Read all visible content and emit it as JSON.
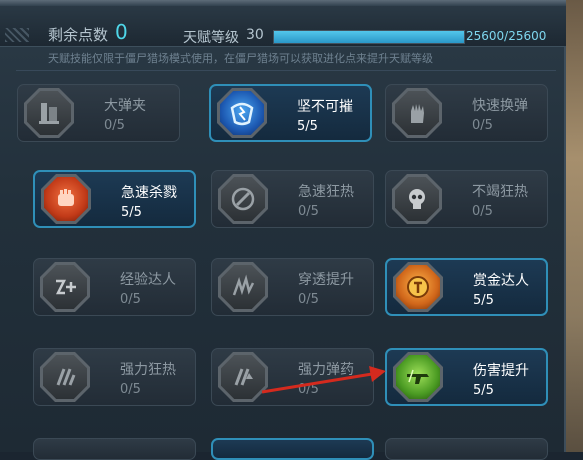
{
  "header": {
    "points_label": "剩余点数",
    "points_value": "0",
    "level_label": "天赋等级",
    "level_value": "30",
    "xp_text": "25600/25600",
    "xp_fraction": 1.0,
    "note": "天赋技能仅限于僵尸猎场模式使用，在僵尸猎场可以获取进化点来提升天赋等级"
  },
  "colors": {
    "accent": "#4fd7e9",
    "active_border": "#2f8fb8",
    "annotation_arrow": "#d42a1e"
  },
  "talents": [
    {
      "name": "大弹夹",
      "level": "0/5",
      "active": false,
      "icon": "magazine-icon"
    },
    {
      "name": "坚不可摧",
      "level": "5/5",
      "active": true,
      "icon": "shield-icon"
    },
    {
      "name": "快速换弹",
      "level": "0/5",
      "active": false,
      "icon": "hand-icon"
    },
    {
      "name": "急速杀戮",
      "level": "5/5",
      "active": true,
      "icon": "fist-icon"
    },
    {
      "name": "急速狂热",
      "level": "0/5",
      "active": false,
      "icon": "speed-icon"
    },
    {
      "name": "不竭狂热",
      "level": "0/5",
      "active": false,
      "icon": "skull-icon"
    },
    {
      "name": "经验达人",
      "level": "0/5",
      "active": false,
      "icon": "plus-icon"
    },
    {
      "name": "穿透提升",
      "level": "0/5",
      "active": false,
      "icon": "pierce-icon"
    },
    {
      "name": "赏金达人",
      "level": "5/5",
      "active": true,
      "icon": "coin-icon"
    },
    {
      "name": "强力狂热",
      "level": "0/5",
      "active": false,
      "icon": "power-icon"
    },
    {
      "name": "强力弹药",
      "level": "0/5",
      "active": false,
      "icon": "ammo-icon"
    },
    {
      "name": "伤害提升",
      "level": "5/5",
      "active": true,
      "icon": "gun-icon"
    }
  ]
}
